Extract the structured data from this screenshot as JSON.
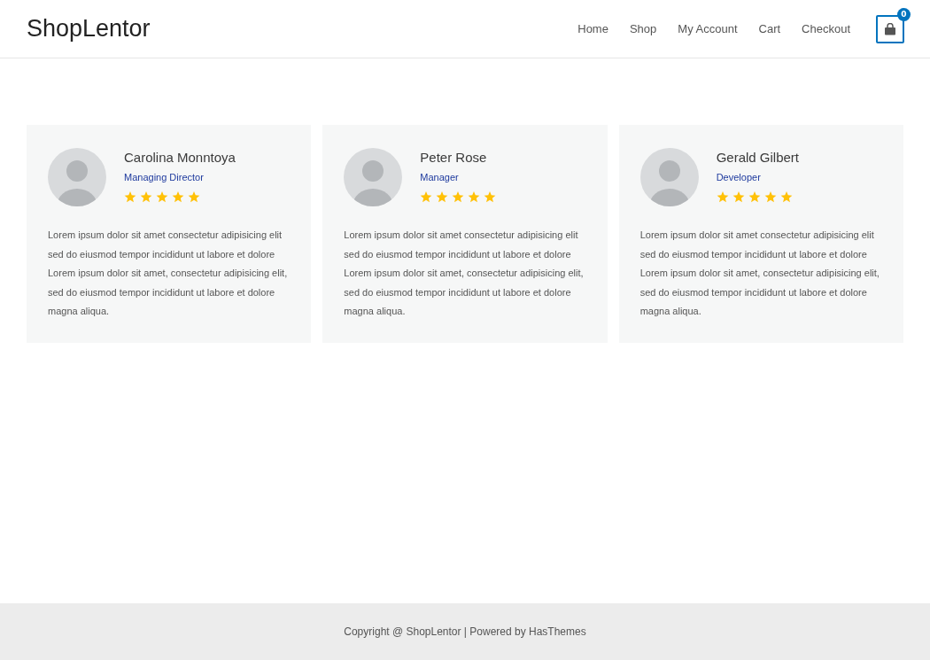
{
  "header": {
    "logo": "ShopLentor",
    "nav": [
      {
        "label": "Home"
      },
      {
        "label": "Shop"
      },
      {
        "label": "My Account"
      },
      {
        "label": "Cart"
      },
      {
        "label": "Checkout"
      }
    ],
    "cart_count": "0"
  },
  "testimonials": [
    {
      "name": "Carolina Monntoya",
      "role": "Managing Director",
      "stars": 5,
      "text": "Lorem ipsum dolor sit amet consectetur adipisicing elit sed do eiusmod tempor incididunt ut labore et dolore Lorem ipsum dolor sit amet, consectetur adipisicing elit, sed do eiusmod tempor incididunt ut labore et dolore magna aliqua."
    },
    {
      "name": "Peter Rose",
      "role": "Manager",
      "stars": 5,
      "text": "Lorem ipsum dolor sit amet consectetur adipisicing elit sed do eiusmod tempor incididunt ut labore et dolore Lorem ipsum dolor sit amet, consectetur adipisicing elit, sed do eiusmod tempor incididunt ut labore et dolore magna aliqua."
    },
    {
      "name": "Gerald Gilbert",
      "role": "Developer",
      "stars": 5,
      "text": "Lorem ipsum dolor sit amet consectetur adipisicing elit sed do eiusmod tempor incididunt ut labore et dolore Lorem ipsum dolor sit amet, consectetur adipisicing elit, sed do eiusmod tempor incididunt ut labore et dolore magna aliqua."
    }
  ],
  "footer": {
    "text": "Copyright @ ShopLentor | Powered by HasThemes"
  }
}
